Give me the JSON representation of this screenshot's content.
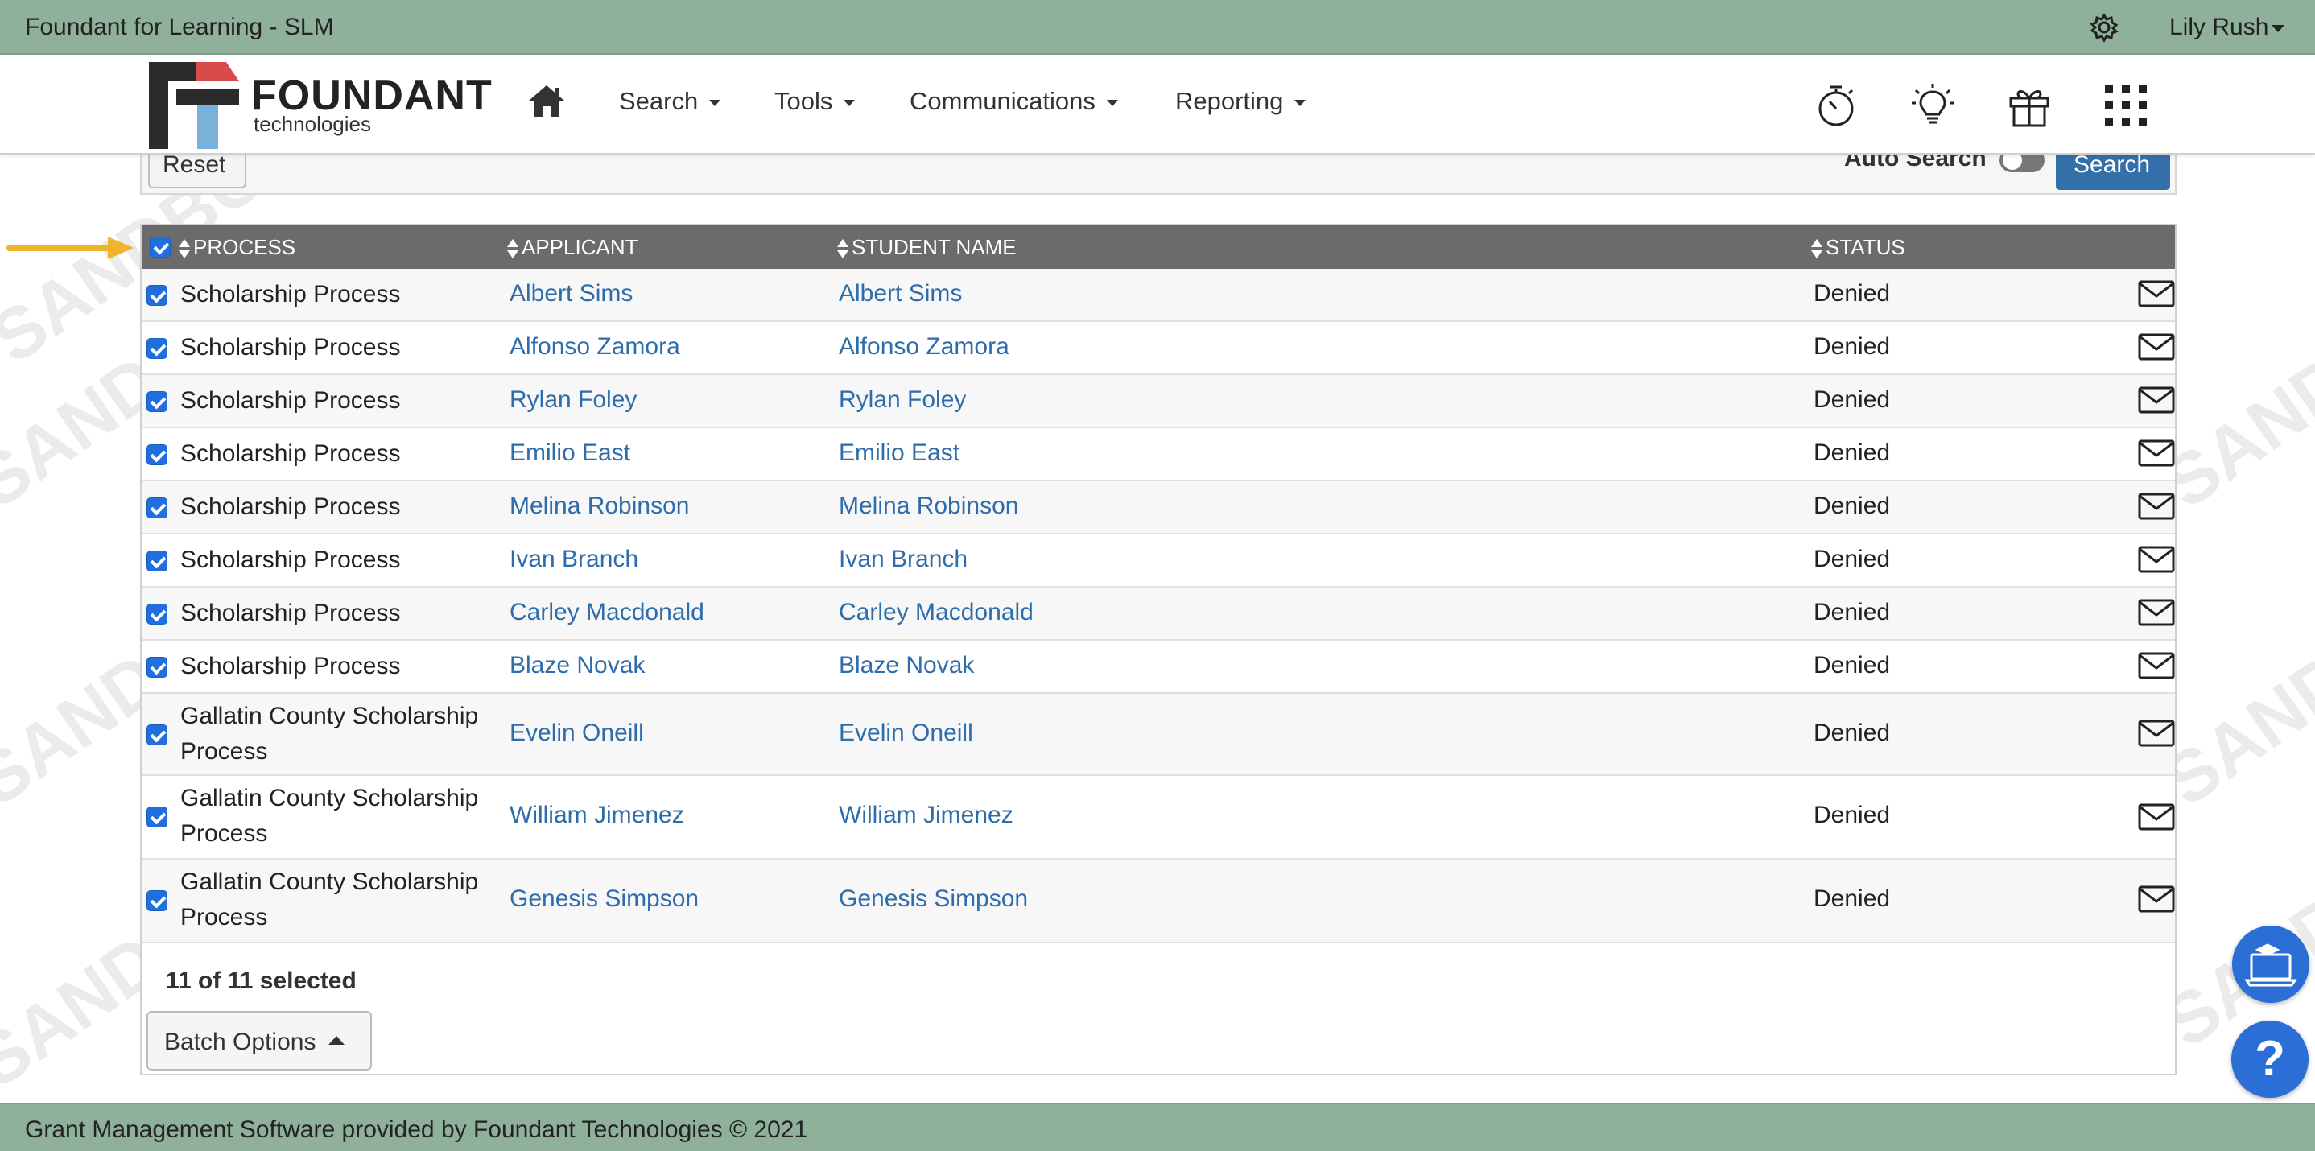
{
  "app": {
    "title": "Foundant for Learning - SLM",
    "user_name": "Lily Rush"
  },
  "logo": {
    "word": "FOUNDANT",
    "sub": "technologies"
  },
  "nav": {
    "items": [
      {
        "label": "Search"
      },
      {
        "label": "Tools"
      },
      {
        "label": "Communications"
      },
      {
        "label": "Reporting"
      }
    ],
    "icons": [
      "home-icon",
      "stopwatch-icon",
      "lightbulb-icon",
      "gift-icon",
      "apps-grid-icon"
    ]
  },
  "search": {
    "reset_label": "Reset",
    "auto_search_label": "Auto Search",
    "search_label": "Search",
    "auto_search_on": false
  },
  "table": {
    "headers": {
      "process": "PROCESS",
      "applicant": "APPLICANT",
      "student": "STUDENT NAME",
      "status": "STATUS"
    },
    "rows": [
      {
        "process": "Scholarship Process",
        "applicant": "Albert Sims",
        "student": "Albert Sims",
        "status": "Denied"
      },
      {
        "process": "Scholarship Process",
        "applicant": "Alfonso Zamora",
        "student": "Alfonso Zamora",
        "status": "Denied"
      },
      {
        "process": "Scholarship Process",
        "applicant": "Rylan Foley",
        "student": "Rylan Foley",
        "status": "Denied"
      },
      {
        "process": "Scholarship Process",
        "applicant": "Emilio East",
        "student": "Emilio East",
        "status": "Denied"
      },
      {
        "process": "Scholarship Process",
        "applicant": "Melina Robinson",
        "student": "Melina Robinson",
        "status": "Denied"
      },
      {
        "process": "Scholarship Process",
        "applicant": "Ivan Branch",
        "student": "Ivan Branch",
        "status": "Denied"
      },
      {
        "process": "Scholarship Process",
        "applicant": "Carley Macdonald",
        "student": "Carley Macdonald",
        "status": "Denied"
      },
      {
        "process": "Scholarship Process",
        "applicant": "Blaze Novak",
        "student": "Blaze Novak",
        "status": "Denied"
      },
      {
        "process_line1": "Gallatin County Scholarship",
        "process_line2": "Process",
        "applicant": "Evelin Oneill",
        "student": "Evelin Oneill",
        "status": "Denied"
      },
      {
        "process_line1": "Gallatin County Scholarship",
        "process_line2": "Process",
        "applicant": "William Jimenez",
        "student": "William Jimenez",
        "status": "Denied"
      },
      {
        "process_line1": "Gallatin County Scholarship",
        "process_line2": "Process",
        "applicant": "Genesis Simpson",
        "student": "Genesis Simpson",
        "status": "Denied"
      }
    ],
    "selection_summary": "11 of 11 selected",
    "batch_label": "Batch Options"
  },
  "footer": {
    "text": "Grant Management Software provided by Foundant Technologies © 2021"
  },
  "help": {
    "label": "?"
  },
  "watermark": "SANDBOX",
  "colors": {
    "topbar": "#8fb09b",
    "link": "#2e6cab",
    "header_bg": "#6b6b6b",
    "checkbox": "#1f6fe0",
    "arrow": "#f0b429",
    "primary_btn": "#336fa8"
  }
}
